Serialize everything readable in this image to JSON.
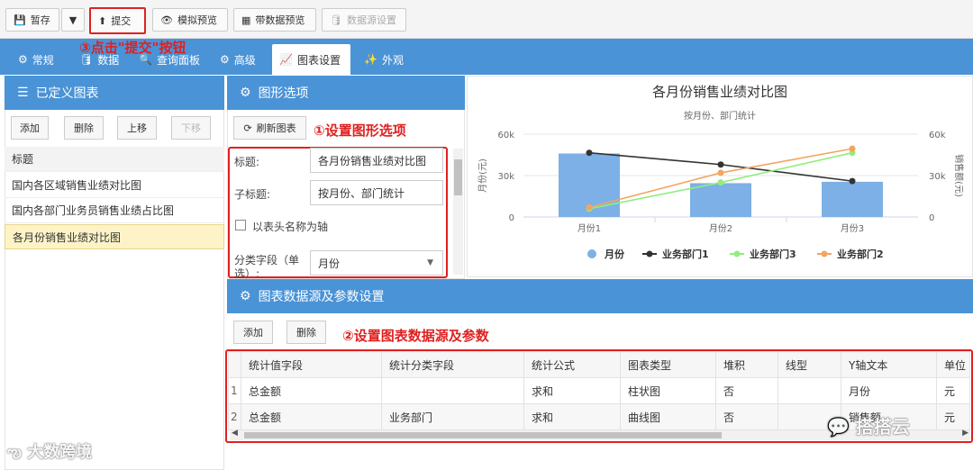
{
  "toolbar": {
    "save": "暂存",
    "submit": "提交",
    "preview": "模拟预览",
    "data_preview": "带数据预览",
    "datasource": "数据源设置"
  },
  "tabs": [
    {
      "label": "常规"
    },
    {
      "label": "数据"
    },
    {
      "label": "查询面板"
    },
    {
      "label": "高级"
    },
    {
      "label": "图表设置"
    },
    {
      "label": "外观"
    }
  ],
  "annotations": {
    "a1": "①设置图形选项",
    "a2": "②设置图表数据源及参数",
    "a3": "③点击\"提交\"按钮"
  },
  "left_panel": {
    "title": "已定义图表",
    "buttons": {
      "add": "添加",
      "delete": "删除",
      "up": "上移",
      "down": "下移"
    },
    "header": "标题",
    "items": [
      "国内各区域销售业绩对比图",
      "国内各部门业务员销售业绩占比图",
      "各月份销售业绩对比图"
    ]
  },
  "options_panel": {
    "title": "图形选项",
    "refresh": "刷新图表",
    "title_label": "标题:",
    "title_value": "各月份销售业绩对比图",
    "subtitle_label": "子标题:",
    "subtitle_value": "按月份、部门统计",
    "checkbox_label": "以表头名称为轴",
    "category_label": "分类字段（单选）:",
    "category_value": "月份"
  },
  "datasource_panel": {
    "title": "图表数据源及参数设置",
    "add": "添加",
    "delete": "删除",
    "columns": [
      "统计值字段",
      "统计分类字段",
      "统计公式",
      "图表类型",
      "堆积",
      "线型",
      "Y轴文本",
      "单位"
    ],
    "rows": [
      {
        "index": "1",
        "cells": [
          "总金额",
          "",
          "求和",
          "柱状图",
          "否",
          "",
          "月份",
          "元"
        ]
      },
      {
        "index": "2",
        "cells": [
          "总金额",
          "业务部门",
          "求和",
          "曲线图",
          "否",
          "",
          "销售额",
          "元"
        ]
      }
    ]
  },
  "watermarks": {
    "left": "大数跨境",
    "right": "搭搭云"
  },
  "chart_data": {
    "type": "bar",
    "title": "各月份销售业绩对比图",
    "subtitle": "按月份、部门统计",
    "categories": [
      "月份1",
      "月份2",
      "月份3"
    ],
    "ylabel": "月份(元)",
    "ylabel_right": "销售额(元)",
    "ylim": [
      0,
      60000
    ],
    "y_ticks": [
      "0",
      "30k",
      "60k"
    ],
    "legend_position": "bottom",
    "series": [
      {
        "name": "月份",
        "kind": "bar",
        "color": "#7cb0e6",
        "values": [
          46000,
          24500,
          25500
        ]
      },
      {
        "name": "业务部门1",
        "kind": "line",
        "color": "#333333",
        "values": [
          46500,
          38000,
          26000
        ]
      },
      {
        "name": "业务部门3",
        "kind": "line",
        "color": "#90ee7e",
        "values": [
          6000,
          25000,
          46500
        ]
      },
      {
        "name": "业务部门2",
        "kind": "line",
        "color": "#f4a460",
        "values": [
          7000,
          32000,
          49500
        ]
      }
    ]
  }
}
